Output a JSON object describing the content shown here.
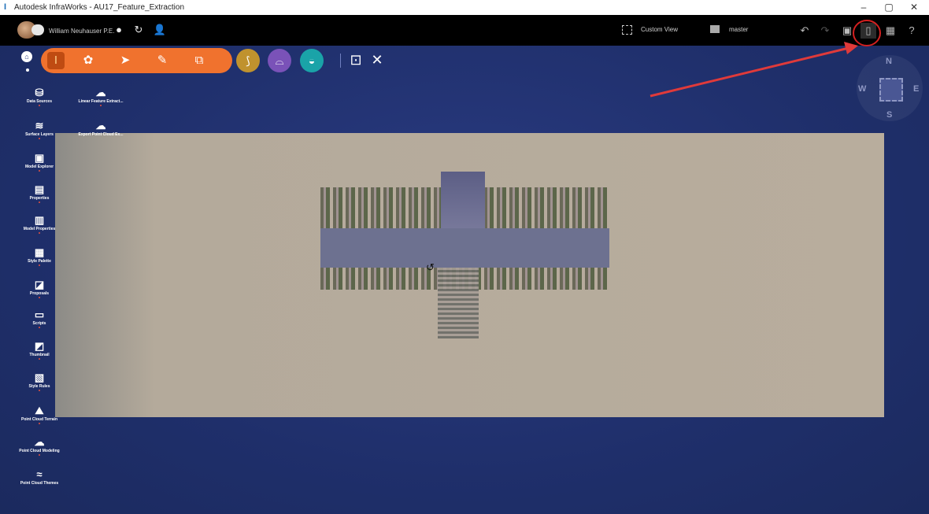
{
  "window": {
    "title": "Autodesk InfraWorks - AU17_Feature_Extraction",
    "minimize": "–",
    "restore": "▢",
    "close": "✕"
  },
  "appbar": {
    "user": "William Neuhauser P.E.",
    "custom_view": "Custom View",
    "branch": "master"
  },
  "toolbar": {
    "home_icon": "home-icon",
    "pill_icons": [
      "build-icon",
      "analyze-icon",
      "select-icon",
      "sketch-icon",
      "copy-icon"
    ],
    "circle_buttons": [
      {
        "name": "roadway-icon",
        "color": "#c0922e"
      },
      {
        "name": "bridge-icon",
        "color": "#7a52b8"
      },
      {
        "name": "drainage-icon",
        "color": "#1aa3a8"
      }
    ],
    "extra_icons": [
      "presentation-icon",
      "settings-tools-icon"
    ]
  },
  "compass": {
    "n": "N",
    "s": "S",
    "e": "E",
    "w": "W"
  },
  "panels": {
    "col1": [
      {
        "label": "Data Sources",
        "icon": "data-sources-icon"
      },
      {
        "label": "Surface Layers",
        "icon": "surface-layers-icon"
      },
      {
        "label": "Model Explorer",
        "icon": "model-explorer-icon"
      },
      {
        "label": "Properties",
        "icon": "properties-icon"
      },
      {
        "label": "Model Properties",
        "icon": "model-properties-icon"
      },
      {
        "label": "Style Palette",
        "icon": "style-palette-icon"
      },
      {
        "label": "Proposals",
        "icon": "proposals-icon"
      },
      {
        "label": "Scripts",
        "icon": "scripts-icon"
      },
      {
        "label": "Thumbnail",
        "icon": "thumbnail-icon"
      },
      {
        "label": "Style Rules",
        "icon": "style-rules-icon"
      },
      {
        "label": "Point Cloud Terrain",
        "icon": "point-cloud-terrain-icon"
      },
      {
        "label": "Point Cloud Modeling",
        "icon": "point-cloud-modeling-icon"
      },
      {
        "label": "Point Cloud Themes",
        "icon": "point-cloud-themes-icon"
      }
    ],
    "col2": [
      {
        "label": "Linear Feature Extract...",
        "icon": "linear-feature-extract-icon"
      },
      {
        "label": "Export Point Cloud Ex...",
        "icon": "export-point-cloud-icon"
      }
    ]
  },
  "colors": {
    "accent_orange": "#f0722e",
    "viewport_bg": "#1f2f6b",
    "annotation_red": "#e03a3a"
  }
}
